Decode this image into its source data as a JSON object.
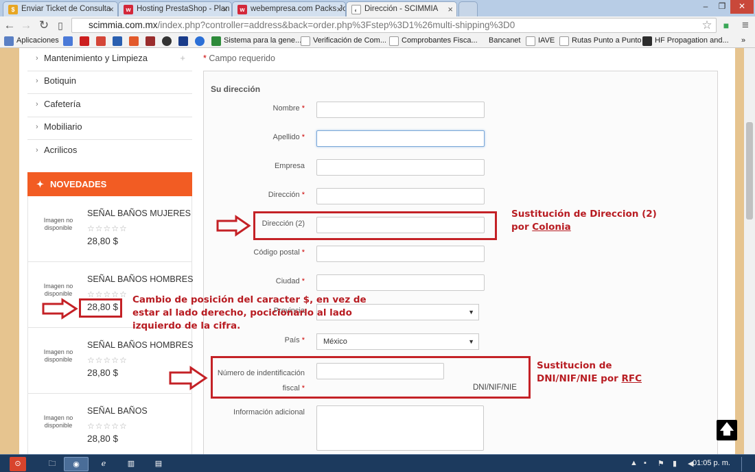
{
  "browser": {
    "tabs": [
      {
        "title": "Enviar Ticket de Consulta",
        "favicon": "S",
        "color": "#e7a623"
      },
      {
        "title": "Hosting PrestaShop - Plan",
        "favicon": "w",
        "color": "#d3283a"
      },
      {
        "title": "webempresa.com Packs Jo",
        "favicon": "w",
        "color": "#d3283a"
      },
      {
        "title": "Dirección - SCIMMIA",
        "favicon": "◐",
        "color": "#999999"
      }
    ],
    "url_host": "scimmia.com.mx",
    "url_path": "/index.php?controller=address&back=order.php%3Fstep%3D1%26multi-shipping%3D0",
    "bookmarks": [
      "Aplicaciones",
      "Sistema para la gene...",
      "Verificación de Com...",
      "Comprobantes Fisca...",
      "Bancanet",
      "IAVE",
      "Rutas Punto a Punto",
      "HF Propagation and..."
    ]
  },
  "sidebar": {
    "categories": [
      "Mantenimiento y Limpieza",
      "Botiquin",
      "Cafetería",
      "Mobiliario",
      "Acrilicos"
    ],
    "category_plus": "+",
    "novedades_title": "NOVEDADES",
    "products": [
      {
        "noimg": "Imagen no disponible",
        "name": "SEÑAL BAÑOS MUJERES",
        "stars": "☆☆☆☆☆",
        "price": "28,80 $"
      },
      {
        "noimg": "Imagen no disponible",
        "name": "SEÑAL BAÑOS HOMBRES",
        "stars": "☆☆☆☆☆",
        "price": "28,80 $"
      },
      {
        "noimg": "Imagen no disponible",
        "name": "SEÑAL BAÑOS HOMBRES",
        "stars": "☆☆☆☆☆",
        "price": "28,80 $"
      },
      {
        "noimg": "Imagen no disponible",
        "name": "SEÑAL BAÑOS",
        "stars": "☆☆☆☆☆",
        "price": "28,80 $"
      }
    ]
  },
  "form": {
    "required_note": "Campo requerido",
    "required_mark": "*",
    "section_title": "Su dirección",
    "fields": {
      "nombre": "Nombre",
      "apellido": "Apellido",
      "empresa": "Empresa",
      "direccion": "Dirección",
      "direccion2": "Dirección (2)",
      "codigo_postal": "Código postal",
      "ciudad": "Ciudad",
      "provincia": "Provincia",
      "pais": "País",
      "pais_value": "México",
      "nif_line1": "Número de indentificación",
      "nif_line2": "fiscal",
      "nif_hint": "DNI/NIF/NIE",
      "info": "Información adicional"
    }
  },
  "annotations": {
    "direccion2_line1": "Sustitución de Direccion (2)",
    "direccion2_line2_prefix": "por ",
    "direccion2_line2_u": "Colonia",
    "price_line1": "Cambio de posición del caracter $, en vez de",
    "price_line2": "estar al lado derecho, pocicionarlo al lado",
    "price_line3": "izquierdo de la cifra.",
    "nif_line1": "Sustitucion de",
    "nif_line2_prefix": "DNI/NIF/NIE por ",
    "nif_line2_u": "RFC",
    "highlighted_price": "28,80 $"
  },
  "taskbar": {
    "clock": "01:05 p. m."
  },
  "colors": {
    "accent_orange": "#f25c23",
    "annotation_red": "#c42126"
  }
}
